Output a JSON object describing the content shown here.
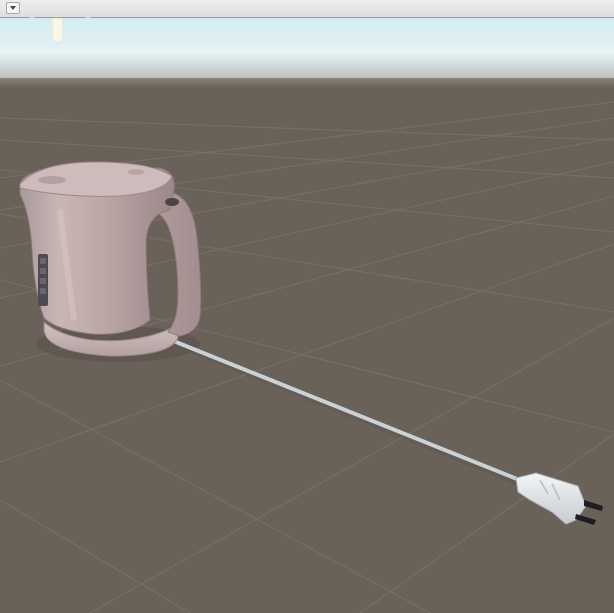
{
  "window": {
    "toolbar": {
      "dropdown_icon": "chevron-down-icon"
    }
  },
  "scene": {
    "sky_colors": [
      "#cfeaf2",
      "#e7f3f6",
      "#bcbdb9"
    ],
    "ground_color": "#6a6159",
    "grid_color": "#7c746c",
    "objects": [
      {
        "name": "electric-kettle",
        "body_color": "#c3afaf",
        "control_panel_color": "#4e4a52"
      },
      {
        "name": "power-cord",
        "color": "#c9d2d6"
      },
      {
        "name": "power-plug",
        "color": "#e7eaec",
        "prong_color": "#1d1d22"
      }
    ]
  }
}
